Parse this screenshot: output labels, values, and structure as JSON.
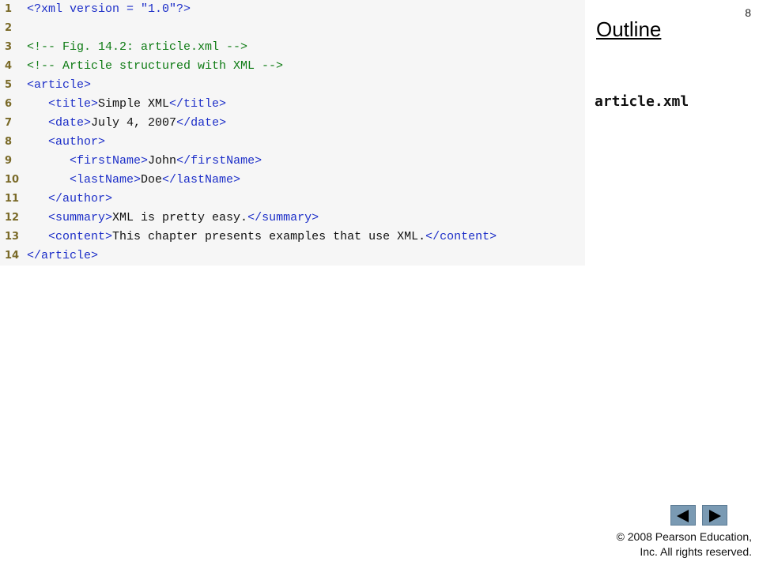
{
  "slide": {
    "page_number": "8",
    "outline_title": "Outline",
    "file_label": "article.xml",
    "copyright_line1": "© 2008 Pearson Education,",
    "copyright_line2": "Inc.  All rights reserved."
  },
  "code_lines": [
    {
      "n": "1",
      "segments": [
        {
          "t": "tag",
          "v": "<?xml version = \""
        },
        {
          "t": "str",
          "v": "1.0"
        },
        {
          "t": "tag",
          "v": "\"?>"
        }
      ]
    },
    {
      "n": "2",
      "segments": []
    },
    {
      "n": "3",
      "segments": [
        {
          "t": "comment",
          "v": "<!-- Fig. 14.2: article.xml -->"
        }
      ]
    },
    {
      "n": "4",
      "segments": [
        {
          "t": "comment",
          "v": "<!-- Article structured with XML -->"
        }
      ]
    },
    {
      "n": "5",
      "segments": [
        {
          "t": "tag",
          "v": "<article>"
        }
      ]
    },
    {
      "n": "6",
      "segments": [
        {
          "t": "text",
          "v": "   "
        },
        {
          "t": "tag",
          "v": "<title>"
        },
        {
          "t": "text",
          "v": "Simple XML"
        },
        {
          "t": "tag",
          "v": "</title>"
        }
      ]
    },
    {
      "n": "7",
      "segments": [
        {
          "t": "text",
          "v": "   "
        },
        {
          "t": "tag",
          "v": "<date>"
        },
        {
          "t": "text",
          "v": "July 4, 2007"
        },
        {
          "t": "tag",
          "v": "</date>"
        }
      ]
    },
    {
      "n": "8",
      "segments": [
        {
          "t": "text",
          "v": "   "
        },
        {
          "t": "tag",
          "v": "<author>"
        }
      ]
    },
    {
      "n": "9",
      "segments": [
        {
          "t": "text",
          "v": "      "
        },
        {
          "t": "tag",
          "v": "<firstName>"
        },
        {
          "t": "text",
          "v": "John"
        },
        {
          "t": "tag",
          "v": "</firstName>"
        }
      ]
    },
    {
      "n": "10",
      "segments": [
        {
          "t": "text",
          "v": "      "
        },
        {
          "t": "tag",
          "v": "<lastName>"
        },
        {
          "t": "text",
          "v": "Doe"
        },
        {
          "t": "tag",
          "v": "</lastName>"
        }
      ]
    },
    {
      "n": "11",
      "segments": [
        {
          "t": "text",
          "v": "   "
        },
        {
          "t": "tag",
          "v": "</author>"
        }
      ]
    },
    {
      "n": "12",
      "segments": [
        {
          "t": "text",
          "v": "   "
        },
        {
          "t": "tag",
          "v": "<summary>"
        },
        {
          "t": "text",
          "v": "XML is pretty easy."
        },
        {
          "t": "tag",
          "v": "</summary>"
        }
      ]
    },
    {
      "n": "13",
      "segments": [
        {
          "t": "text",
          "v": "   "
        },
        {
          "t": "tag",
          "v": "<content>"
        },
        {
          "t": "text",
          "v": "This chapter presents examples that use XML."
        },
        {
          "t": "tag",
          "v": "</content>"
        }
      ]
    },
    {
      "n": "14",
      "segments": [
        {
          "t": "tag",
          "v": "</article>"
        }
      ]
    }
  ],
  "nav": {
    "prev_icon": "triangle-left-icon",
    "next_icon": "triangle-right-icon",
    "button_color": "#7a9ab3"
  }
}
